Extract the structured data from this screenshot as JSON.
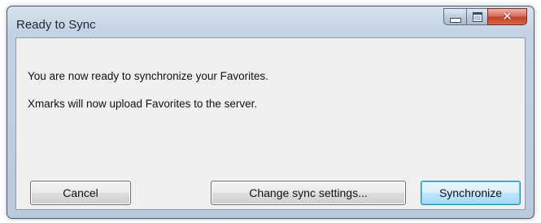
{
  "window": {
    "title": "Ready to Sync",
    "controls": {
      "minimize": "minimize-icon",
      "maximize": "maximize-icon",
      "close": "close-icon"
    }
  },
  "message": {
    "line1": "You are now ready to synchronize your Favorites.",
    "line2": "Xmarks will now upload Favorites to the server."
  },
  "buttons": {
    "cancel": "Cancel",
    "change_settings": "Change sync settings...",
    "synchronize": "Synchronize"
  },
  "colors": {
    "title_bar": "#c3d3e3",
    "close_button": "#c4432c",
    "default_button_border": "#3c7fb1"
  }
}
